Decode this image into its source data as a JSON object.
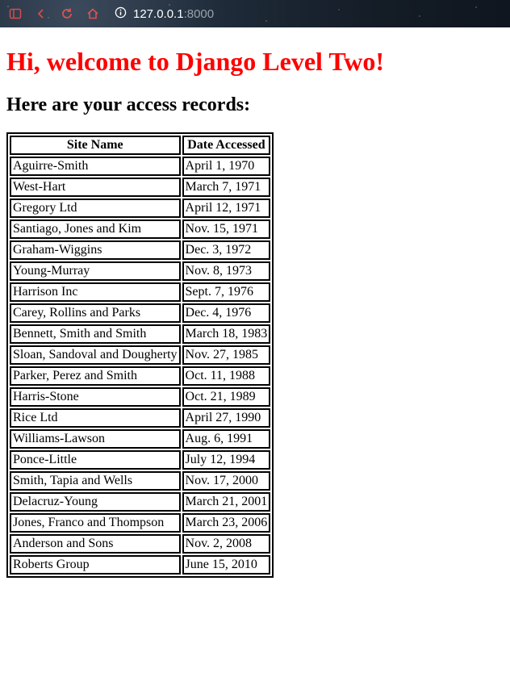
{
  "browser": {
    "url_host": "127.0.0.1",
    "url_port": ":8000",
    "icons": [
      "sidebar-icon",
      "back-icon",
      "reload-icon",
      "home-icon",
      "info-icon"
    ]
  },
  "page": {
    "title": "Hi, welcome to Django Level Two!",
    "subtitle": "Here are your access records:",
    "title_color": "#ff0000"
  },
  "table": {
    "headers": [
      "Site Name",
      "Date Accessed"
    ],
    "rows": [
      [
        "Aguirre-Smith",
        "April 1, 1970"
      ],
      [
        "West-Hart",
        "March 7, 1971"
      ],
      [
        "Gregory Ltd",
        "April 12, 1971"
      ],
      [
        "Santiago, Jones and Kim",
        "Nov. 15, 1971"
      ],
      [
        "Graham-Wiggins",
        "Dec. 3, 1972"
      ],
      [
        "Young-Murray",
        "Nov. 8, 1973"
      ],
      [
        "Harrison Inc",
        "Sept. 7, 1976"
      ],
      [
        "Carey, Rollins and Parks",
        "Dec. 4, 1976"
      ],
      [
        "Bennett, Smith and Smith",
        "March 18, 1983"
      ],
      [
        "Sloan, Sandoval and Dougherty",
        "Nov. 27, 1985"
      ],
      [
        "Parker, Perez and Smith",
        "Oct. 11, 1988"
      ],
      [
        "Harris-Stone",
        "Oct. 21, 1989"
      ],
      [
        "Rice Ltd",
        "April 27, 1990"
      ],
      [
        "Williams-Lawson",
        "Aug. 6, 1991"
      ],
      [
        "Ponce-Little",
        "July 12, 1994"
      ],
      [
        "Smith, Tapia and Wells",
        "Nov. 17, 2000"
      ],
      [
        "Delacruz-Young",
        "March 21, 2001"
      ],
      [
        "Jones, Franco and Thompson",
        "March 23, 2006"
      ],
      [
        "Anderson and Sons",
        "Nov. 2, 2008"
      ],
      [
        "Roberts Group",
        "June 15, 2010"
      ]
    ]
  }
}
